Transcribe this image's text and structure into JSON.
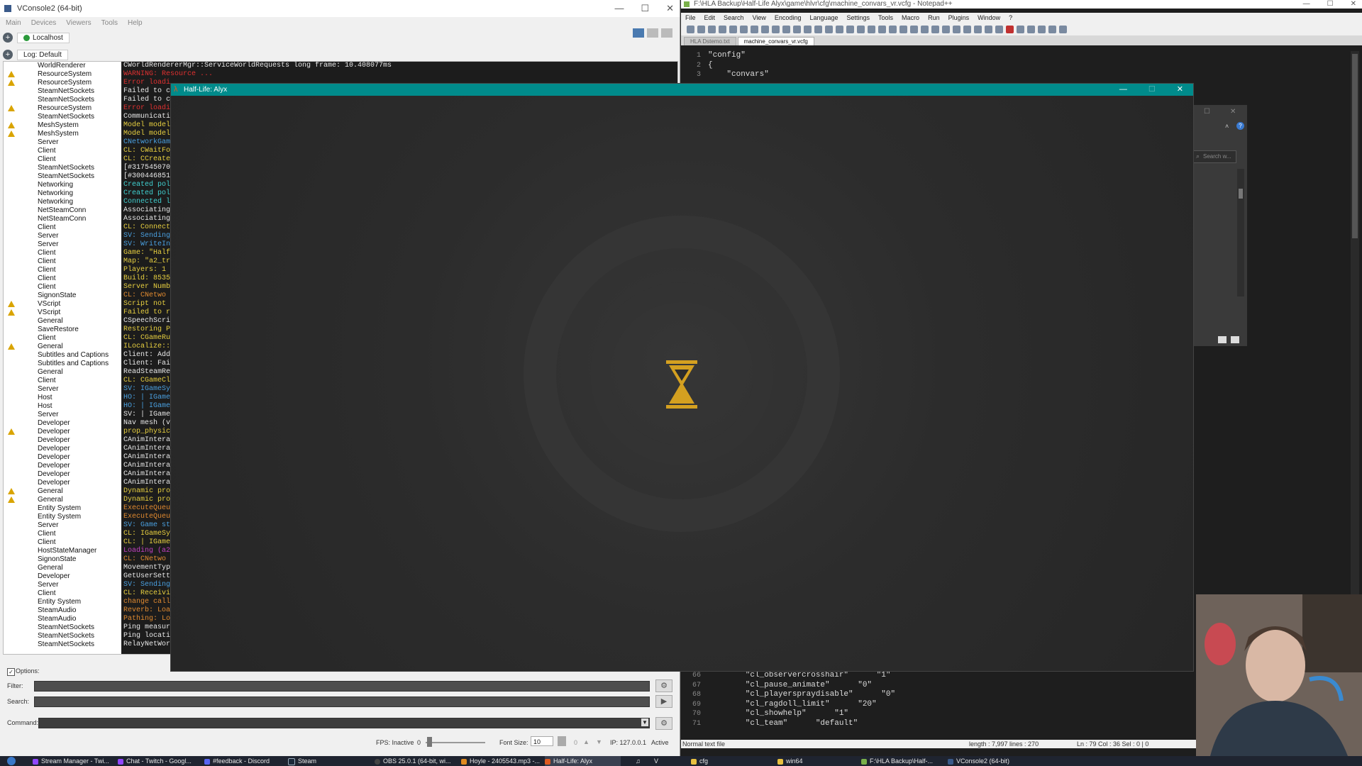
{
  "vconsole": {
    "title": "VConsole2 (64-bit)",
    "menu": [
      "Main",
      "Devices",
      "Viewers",
      "Tools",
      "Help"
    ],
    "host": "Localhost",
    "log_tab": "Log: Default",
    "log_rows": [
      {
        "cat": "WorldRenderer",
        "msg": "CWorldRendererMgr::ServiceWorldRequests long frame: 10.408077ms",
        "color": "#e8e8e8",
        "warn": false
      },
      {
        "cat": "ResourceSystem",
        "msg": "WARNING: Resource ...",
        "color": "#e03030",
        "warn": true
      },
      {
        "cat": "ResourceSystem",
        "msg": "Error loadi",
        "color": "#e03030",
        "warn": true
      },
      {
        "cat": "SteamNetSockets",
        "msg": "Failed to co",
        "color": "#e8e8e8",
        "warn": false
      },
      {
        "cat": "SteamNetSockets",
        "msg": "Failed to co",
        "color": "#e8e8e8",
        "warn": false
      },
      {
        "cat": "ResourceSystem",
        "msg": "Error loadi",
        "color": "#e03030",
        "warn": true
      },
      {
        "cat": "SteamNetSockets",
        "msg": "Communicatio",
        "color": "#e8e8e8",
        "warn": false
      },
      {
        "cat": "MeshSystem",
        "msg": "Model models",
        "color": "#e8d040",
        "warn": true
      },
      {
        "cat": "MeshSystem",
        "msg": "Model models",
        "color": "#e8d040",
        "warn": true
      },
      {
        "cat": "Server",
        "msg": "CNetworkGame",
        "color": "#4aa0e0",
        "warn": false
      },
      {
        "cat": "Client",
        "msg": "CL:  CWaitFo",
        "color": "#e8d040",
        "warn": false
      },
      {
        "cat": "Client",
        "msg": "CL:  CCreate",
        "color": "#e8d040",
        "warn": false
      },
      {
        "cat": "SteamNetSockets",
        "msg": "[#317545070",
        "color": "#e8e8e8",
        "warn": false
      },
      {
        "cat": "SteamNetSockets",
        "msg": "[#300446851",
        "color": "#e8e8e8",
        "warn": false
      },
      {
        "cat": "Networking",
        "msg": "Created poll",
        "color": "#40d0d0",
        "warn": false
      },
      {
        "cat": "Networking",
        "msg": "Created poll",
        "color": "#40d0d0",
        "warn": false
      },
      {
        "cat": "Networking",
        "msg": "Connected lo",
        "color": "#40d0d0",
        "warn": false
      },
      {
        "cat": "NetSteamConn",
        "msg": "Associating",
        "color": "#e8e8e8",
        "warn": false
      },
      {
        "cat": "NetSteamConn",
        "msg": "Associating",
        "color": "#e8e8e8",
        "warn": false
      },
      {
        "cat": "Client",
        "msg": "CL:  Connect",
        "color": "#e8d040",
        "warn": false
      },
      {
        "cat": "Server",
        "msg": "SV:  Sending",
        "color": "#4aa0e0",
        "warn": false
      },
      {
        "cat": "Server",
        "msg": "SV:  WriteIn",
        "color": "#4aa0e0",
        "warn": false
      },
      {
        "cat": "Client",
        "msg": "Game: \"Half-",
        "color": "#e8d040",
        "warn": false
      },
      {
        "cat": "Client",
        "msg": "Map: \"a2_tra",
        "color": "#e8d040",
        "warn": false
      },
      {
        "cat": "Client",
        "msg": "Players: 1 (",
        "color": "#e8d040",
        "warn": false
      },
      {
        "cat": "Client",
        "msg": "Build: 8535",
        "color": "#e8d040",
        "warn": false
      },
      {
        "cat": "Client",
        "msg": "Server Numbe",
        "color": "#e8d040",
        "warn": false
      },
      {
        "cat": "SignonState",
        "msg": "CL:  CNetwo",
        "color": "#e08a30",
        "warn": false
      },
      {
        "cat": "VScript",
        "msg": "Script not f",
        "color": "#e8d040",
        "warn": true
      },
      {
        "cat": "VScript",
        "msg": "Failed to ru",
        "color": "#e8d040",
        "warn": true
      },
      {
        "cat": "General",
        "msg": "CSpeechScrip",
        "color": "#e8e8e8",
        "warn": false
      },
      {
        "cat": "SaveRestore",
        "msg": "Restoring Pe",
        "color": "#e8d040",
        "warn": false
      },
      {
        "cat": "Client",
        "msg": "CL:  CGameRu",
        "color": "#e8d040",
        "warn": false
      },
      {
        "cat": "General",
        "msg": "ILocalize::A",
        "color": "#e8d040",
        "warn": true
      },
      {
        "cat": "Subtitles and Captions",
        "msg": "Client: Adde",
        "color": "#e8e8e8",
        "warn": false
      },
      {
        "cat": "Subtitles and Captions",
        "msg": "Client: Fail",
        "color": "#e8e8e8",
        "warn": false
      },
      {
        "cat": "General",
        "msg": "ReadSteamRem",
        "color": "#e8e8e8",
        "warn": false
      },
      {
        "cat": "Client",
        "msg": "CL:  CGameCl",
        "color": "#e8d040",
        "warn": false
      },
      {
        "cat": "Server",
        "msg": "SV:  IGameSy",
        "color": "#4aa0e0",
        "warn": false
      },
      {
        "cat": "Host",
        "msg": "HO:  | IGameS",
        "color": "#4aa0e0",
        "warn": false
      },
      {
        "cat": "Host",
        "msg": "HO:  | IGame",
        "color": "#4aa0e0",
        "warn": false
      },
      {
        "cat": "Server",
        "msg": "SV:  | IGame",
        "color": "#e8e8e8",
        "warn": false
      },
      {
        "cat": "Developer",
        "msg": "Nav mesh (v3",
        "color": "#e8e8e8",
        "warn": false
      },
      {
        "cat": "Developer",
        "msg": "prop_physics",
        "color": "#e8d040",
        "warn": true
      },
      {
        "cat": "Developer",
        "msg": "CAnimInterac",
        "color": "#e8e8e8",
        "warn": false
      },
      {
        "cat": "Developer",
        "msg": "CAnimInterac",
        "color": "#e8e8e8",
        "warn": false
      },
      {
        "cat": "Developer",
        "msg": "CAnimInterac",
        "color": "#e8e8e8",
        "warn": false
      },
      {
        "cat": "Developer",
        "msg": "CAnimInterac",
        "color": "#e8e8e8",
        "warn": false
      },
      {
        "cat": "Developer",
        "msg": "CAnimInterac",
        "color": "#e8e8e8",
        "warn": false
      },
      {
        "cat": "Developer",
        "msg": "CAnimInterac",
        "color": "#e8e8e8",
        "warn": false
      },
      {
        "cat": "General",
        "msg": "Dynamic prop",
        "color": "#e8d040",
        "warn": true
      },
      {
        "cat": "General",
        "msg": "Dynamic prop",
        "color": "#e8d040",
        "warn": true
      },
      {
        "cat": "Entity System",
        "msg": "ExecuteQueue",
        "color": "#e08a30",
        "warn": false
      },
      {
        "cat": "Entity System",
        "msg": "ExecuteQueue",
        "color": "#e08a30",
        "warn": false
      },
      {
        "cat": "Server",
        "msg": "SV:  Game st",
        "color": "#4aa0e0",
        "warn": false
      },
      {
        "cat": "Client",
        "msg": "CL:  IGameSy",
        "color": "#e8d040",
        "warn": false
      },
      {
        "cat": "Client",
        "msg": "CL:  | IGame",
        "color": "#e8d040",
        "warn": false
      },
      {
        "cat": "HostStateManager",
        "msg": "Loading (a2_",
        "color": "#c040c0",
        "warn": false
      },
      {
        "cat": "SignonState",
        "msg": "CL:  CNetwo",
        "color": "#e08a30",
        "warn": false
      },
      {
        "cat": "General",
        "msg": "MovementType",
        "color": "#e8e8e8",
        "warn": false
      },
      {
        "cat": "Developer",
        "msg": "GetUserSetti",
        "color": "#e8e8e8",
        "warn": false
      },
      {
        "cat": "Server",
        "msg": "SV:  Sending",
        "color": "#4aa0e0",
        "warn": false
      },
      {
        "cat": "Client",
        "msg": "CL:  Receivi",
        "color": "#e8d040",
        "warn": false
      },
      {
        "cat": "Entity System",
        "msg": "change calll",
        "color": "#e08a30",
        "warn": false
      },
      {
        "cat": "SteamAudio",
        "msg": "Reverb: Load",
        "color": "#e08a30",
        "warn": false
      },
      {
        "cat": "SteamAudio",
        "msg": "Pathing: Loa",
        "color": "#e08a30",
        "warn": false
      },
      {
        "cat": "SteamNetSockets",
        "msg": "Ping measure",
        "color": "#e8e8e8",
        "warn": false
      },
      {
        "cat": "SteamNetSockets",
        "msg": "Ping locatio",
        "color": "#e8e8e8",
        "warn": false
      },
      {
        "cat": "SteamNetSockets",
        "msg": "RelayNetWork",
        "color": "#e8e8e8",
        "warn": false
      }
    ],
    "options_label": "Options:",
    "filter_label": "Filter:",
    "search_label": "Search:",
    "command_label": "Command:",
    "fps_label": "FPS: Inactive",
    "fps_value": "0",
    "font_size_label": "Font Size:",
    "font_size_value": "10",
    "counter_value": "0",
    "ip_label": "IP: 127.0.0.1",
    "active_label": "Active"
  },
  "npp": {
    "title": "F:\\HLA Backup\\Half-Life Alyx\\game\\hlvr\\cfg\\machine_convars_vr.vcfg - Notepad++",
    "menu": [
      "File",
      "Edit",
      "Search",
      "View",
      "Encoding",
      "Language",
      "Settings",
      "Tools",
      "Macro",
      "Run",
      "Plugins",
      "Window",
      "?"
    ],
    "tabs": [
      "HLA Dstemo.txt",
      "machine_convars_vr.vcfg"
    ],
    "top_lines": [
      {
        "n": "1",
        "t": "\"config\""
      },
      {
        "n": "2",
        "t": "{"
      },
      {
        "n": "3",
        "t": "    \"convars\""
      }
    ],
    "bottom_lines": [
      {
        "n": "66",
        "t": "        \"cl_observercrosshair\"      \"1\""
      },
      {
        "n": "67",
        "t": "        \"cl_pause_animate\"      \"0\""
      },
      {
        "n": "68",
        "t": "        \"cl_playerspraydisable\"      \"0\""
      },
      {
        "n": "69",
        "t": "        \"cl_ragdoll_limit\"      \"20\""
      },
      {
        "n": "70",
        "t": "        \"cl_showhelp\"      \"1\""
      },
      {
        "n": "71",
        "t": "        \"cl_team\"      \"default\""
      }
    ],
    "status_type": "Normal text file",
    "status_length": "length : 7,997    lines : 270",
    "status_pos": "Ln : 79    Col : 36    Sel : 0 | 0"
  },
  "side_panel": {
    "search_placeholder": "Search w..."
  },
  "hla": {
    "title": "Half-Life: Alyx",
    "loading_color": "#d4a020"
  },
  "taskbar": {
    "items": [
      "Stream Manager - Twi...",
      "Chat - Twitch - Googl...",
      "#feedback - Discord",
      "Steam",
      "OBS 25.0.1 (64-bit, wi...",
      "Hoyle - 2405543.mp3 -...",
      "Half-Life: Alyx",
      "cfg",
      "win64",
      "F:\\HLA Backup\\Half-...",
      "VConsole2 (64-bit)"
    ]
  }
}
